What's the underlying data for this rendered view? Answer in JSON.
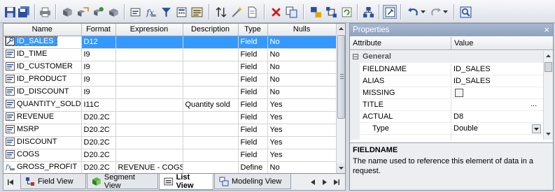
{
  "grid": {
    "columns": [
      "Name",
      "Format",
      "Expression",
      "Description",
      "Type",
      "Nulls"
    ],
    "rows": [
      {
        "name": "ID_SALES",
        "format": "D12",
        "expression": "",
        "description": "",
        "type": "Field",
        "nulls": "No",
        "icon": "key-field-icon"
      },
      {
        "name": "ID_TIME",
        "format": "I9",
        "expression": "",
        "description": "",
        "type": "Field",
        "nulls": "No",
        "icon": "field-icon"
      },
      {
        "name": "ID_CUSTOMER",
        "format": "I9",
        "expression": "",
        "description": "",
        "type": "Field",
        "nulls": "No",
        "icon": "field-icon"
      },
      {
        "name": "ID_PRODUCT",
        "format": "I9",
        "expression": "",
        "description": "",
        "type": "Field",
        "nulls": "No",
        "icon": "field-icon"
      },
      {
        "name": "ID_DISCOUNT",
        "format": "I9",
        "expression": "",
        "description": "",
        "type": "Field",
        "nulls": "No",
        "icon": "field-icon"
      },
      {
        "name": "QUANTITY_SOLD",
        "format": "I11C",
        "expression": "",
        "description": "Quantity sold",
        "type": "Field",
        "nulls": "Yes",
        "icon": "field-icon"
      },
      {
        "name": "REVENUE",
        "format": "D20.2C",
        "expression": "",
        "description": "",
        "type": "Field",
        "nulls": "Yes",
        "icon": "field-icon"
      },
      {
        "name": "MSRP",
        "format": "D20.2C",
        "expression": "",
        "description": "",
        "type": "Field",
        "nulls": "Yes",
        "icon": "field-icon"
      },
      {
        "name": "DISCOUNT",
        "format": "D20.2C",
        "expression": "",
        "description": "",
        "type": "Field",
        "nulls": "Yes",
        "icon": "field-icon"
      },
      {
        "name": "COGS",
        "format": "D20.2C",
        "expression": "",
        "description": "",
        "type": "Field",
        "nulls": "Yes",
        "icon": "field-icon"
      },
      {
        "name": "GROSS_PROFIT",
        "format": "D20.2C",
        "expression": "REVENUE - COGS",
        "description": "",
        "type": "Define",
        "nulls": "No",
        "icon": "define-field-icon"
      }
    ],
    "selected_row": 0
  },
  "tabs": {
    "field_view": "Field View",
    "segment_view": "Segment View",
    "list_view": "List View",
    "modeling_view": "Modeling View",
    "active": "List View"
  },
  "properties": {
    "title": "Properties",
    "close": "×",
    "col_attribute": "Attribute",
    "col_value": "Value",
    "group": "General",
    "group_toggle": "⊟",
    "rows": [
      {
        "key": "FIELDNAME",
        "value": ""
      },
      {
        "key": "ALIAS",
        "value": ""
      },
      {
        "key": "MISSING",
        "value": ""
      },
      {
        "key": "TITLE",
        "value": ""
      },
      {
        "key": "ACTUAL",
        "value": "D8"
      },
      {
        "key": "Type",
        "value": "Double"
      }
    ],
    "fieldname_value": "ID_SALES",
    "alias_value": "ID_SALES",
    "title_button": "...",
    "desc_title": "FIELDNAME",
    "desc_text": "The name used to reference this element of data in a request."
  },
  "colors": {
    "selection": "#3399ff",
    "panel_title": "#9aadc8"
  }
}
